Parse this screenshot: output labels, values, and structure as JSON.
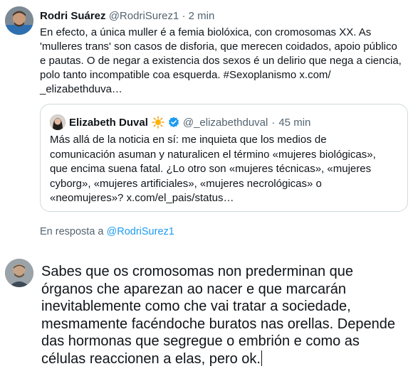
{
  "tweet": {
    "author_name": "Rodri Suárez",
    "author_handle": "@RodriSurez1",
    "separator": "·",
    "time": "2 min",
    "text_lines": [
      "En efecto, a única muller é a femia biolóxica, con cromosomas XX. As",
      "'mulleres trans' son casos de disforia, que merecen coidados, apoio público",
      "e pautas. O de negar a existencia dos sexos é un delirio que nega a ciencia,",
      "polo tanto incompatible coa esquerda. #Sexoplanismo x.com/",
      "_elizabethduva…"
    ]
  },
  "quoted_tweet": {
    "author_name": "Elizabeth Duval",
    "author_handle": "@_elizabethduval",
    "separator": "·",
    "time": "45 min",
    "text_lines": [
      "Más allá de la noticia en sí: me inquieta que los medios de",
      "comunicación asuman y naturalicen el término «mujeres biológicas»,",
      "que encima suena fatal. ¿Lo otro son «mujeres técnicas», «mujeres",
      "cyborg», «mujeres artificiales», «mujeres necrológicas» o",
      "«neomujeres»? x.com/el_pais/status…"
    ]
  },
  "reply_context": {
    "prefix": "En resposta a",
    "handle": "@RodriSurez1"
  },
  "compose": {
    "text_lines": [
      "Sabes que os cromosomas non prederminan que",
      "órganos che aparezan ao nacer e que marcarán",
      "inevitablemente como che vai tratar a sociedade,",
      "mesmamente facéndoche buratos nas orellas. Depende",
      "das hormonas que segregue o embrión e como as",
      "células reaccionen a elas, pero ok."
    ]
  },
  "icons": {
    "verified": "verified-badge-icon",
    "sun": "sun-emoji-icon"
  },
  "colors": {
    "link": "#1d9bf0",
    "muted": "#536471",
    "text": "#0f1419",
    "border": "#cfd9de"
  }
}
